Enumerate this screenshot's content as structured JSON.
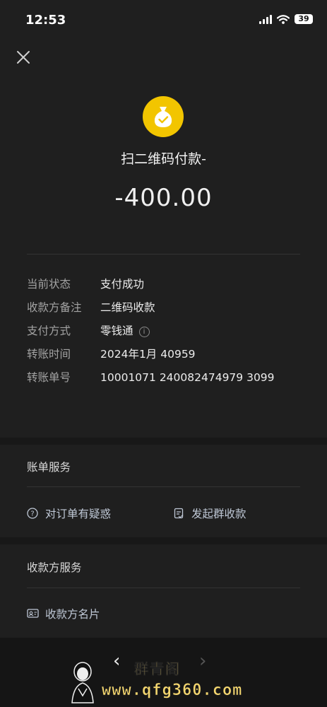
{
  "status_bar": {
    "time": "12:53",
    "battery": "39"
  },
  "payment": {
    "merchant_title": "扫二维码付款-",
    "amount": "-400.00"
  },
  "details": [
    {
      "label": "当前状态",
      "value": "支付成功"
    },
    {
      "label": "收款方备注",
      "value": "二维码收款"
    },
    {
      "label": "支付方式",
      "value": "零钱通"
    },
    {
      "label": "转账时间",
      "value": "2024年1月      40959"
    },
    {
      "label": "转账单号",
      "value": "10001071            240082474979 3099"
    }
  ],
  "bill_service": {
    "title": "账单服务",
    "question_label": "对订单有疑惑",
    "group_collect_label": "发起群收款"
  },
  "payee_service": {
    "title": "收款方服务",
    "card_label": "收款方名片"
  },
  "navigation": {
    "back": "‹",
    "forward": "›"
  },
  "watermark": {
    "name": "群青阁",
    "url": "www.qfg360.com"
  },
  "colors": {
    "accent_yellow": "#f2c500",
    "background": "#1f1f1f",
    "link": "#bfc8d6"
  }
}
